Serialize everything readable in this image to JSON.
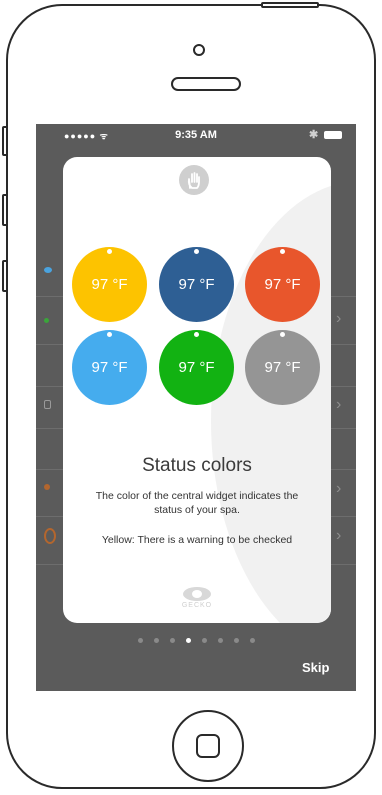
{
  "status_bar": {
    "signal": "●●●●● ᯤ",
    "time": "9:35 AM"
  },
  "card": {
    "swatches": [
      {
        "label": "97 °F",
        "color": "#fdc300"
      },
      {
        "label": "97 °F",
        "color": "#2e5f94"
      },
      {
        "label": "97 °F",
        "color": "#e8562c"
      },
      {
        "label": "97 °F",
        "color": "#45acee"
      },
      {
        "label": "97 °F",
        "color": "#12b212"
      },
      {
        "label": "97 °F",
        "color": "#959595"
      }
    ],
    "title": "Status colors",
    "description": "The color of the central widget indicates the status of your spa.",
    "note": "Yellow: There is a warning to be checked",
    "logo_text": "GECKO"
  },
  "pager": {
    "pages": 8,
    "active_index": 3
  },
  "skip_label": "Skip",
  "icons": [
    "hand-icon",
    "gecko-logo-icon",
    "bluetooth-icon",
    "battery-icon",
    "chevron-right-icon"
  ]
}
